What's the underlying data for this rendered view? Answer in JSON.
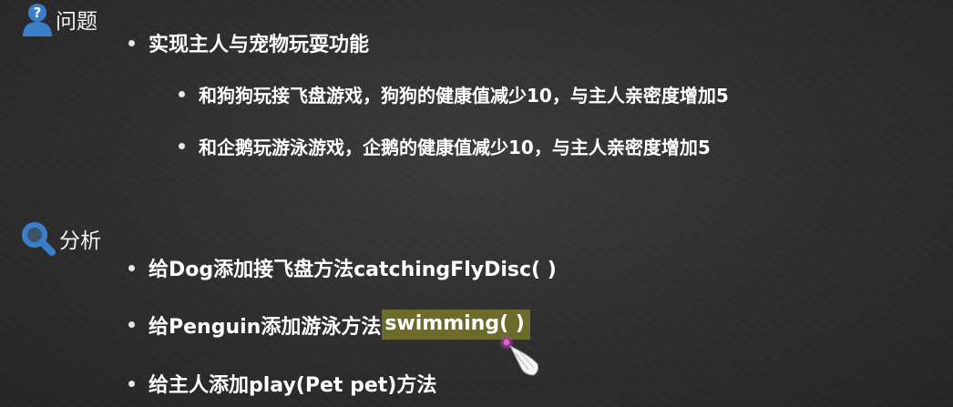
{
  "problem": {
    "heading": "问题",
    "icon": "user-question-icon",
    "main_item": "实现主人与宠物玩耍功能",
    "sub_items": [
      "和狗狗玩接飞盘游戏，狗狗的健康值减少10，与主人亲密度增加5",
      "和企鹅玩游泳游戏，企鹅的健康值减少10，与主人亲密度增加5"
    ]
  },
  "analysis": {
    "heading": "分析",
    "icon": "magnifier-icon",
    "items": [
      {
        "text": "给Dog添加接飞盘方法catchingFlyDisc( )"
      },
      {
        "prefix": "给Penguin添加游泳方法",
        "highlight": "swimming( )"
      },
      {
        "text": "给主人添加play(Pet pet)方法"
      }
    ]
  },
  "colors": {
    "background": "#2e2e2e",
    "icon_blue": "#3a7ec9",
    "highlight": "#6b6b2c",
    "cursor_dot": "#c23fbf"
  }
}
